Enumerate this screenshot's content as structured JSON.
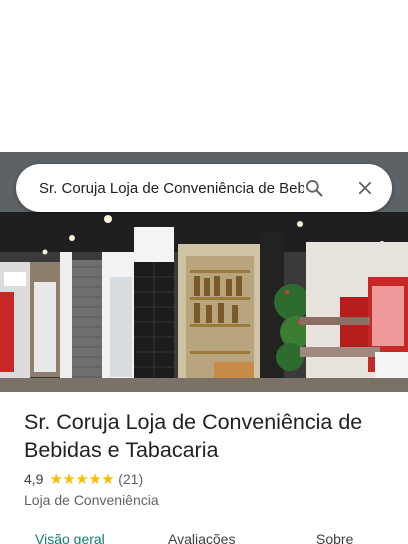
{
  "search": {
    "query": "Sr. Coruja Loja de Conveniência de Bebidas e Tabacaria",
    "icons": {
      "search": "search-icon",
      "close": "close-icon"
    }
  },
  "place": {
    "name": "Sr. Coruja Loja de Conveniência de Bebidas e Tabacaria",
    "rating": "4,9",
    "stars": 5,
    "review_count": "(21)",
    "category": "Loja de Conveniência"
  },
  "tabs": [
    {
      "label": "Visão geral",
      "active": true
    },
    {
      "label": "Avaliações",
      "active": false
    },
    {
      "label": "Sobre",
      "active": false
    }
  ],
  "colors": {
    "accent": "#137c73",
    "star": "#fbbc04",
    "text": "#202124"
  }
}
